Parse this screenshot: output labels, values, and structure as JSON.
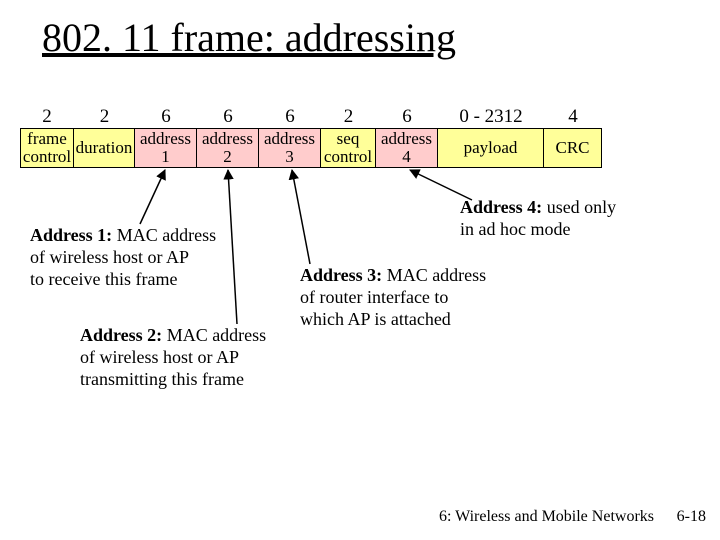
{
  "title": "802. 11 frame: addressing",
  "frame": {
    "sizes": [
      "2",
      "2",
      "6",
      "6",
      "6",
      "2",
      "6",
      "0 - 2312",
      "4"
    ],
    "fields": [
      "frame\ncontrol",
      "duration",
      "address\n1",
      "address\n2",
      "address\n3",
      "seq\ncontrol",
      "address\n4",
      "payload",
      "CRC"
    ]
  },
  "notes": {
    "addr1": {
      "lead": "Address 1:",
      "body": " MAC address\nof wireless host or AP\nto receive this frame"
    },
    "addr2": {
      "lead": "Address 2:",
      "body": " MAC address\nof wireless host or AP\ntransmitting this frame"
    },
    "addr3": {
      "lead": "Address 3:",
      "body": " MAC address\nof router interface to\nwhich AP is attached"
    },
    "addr4": {
      "lead": "Address 4:",
      "body": " used only\nin ad hoc mode"
    }
  },
  "footer": {
    "chapter": "6: Wireless and Mobile Networks",
    "page": "6-18"
  }
}
